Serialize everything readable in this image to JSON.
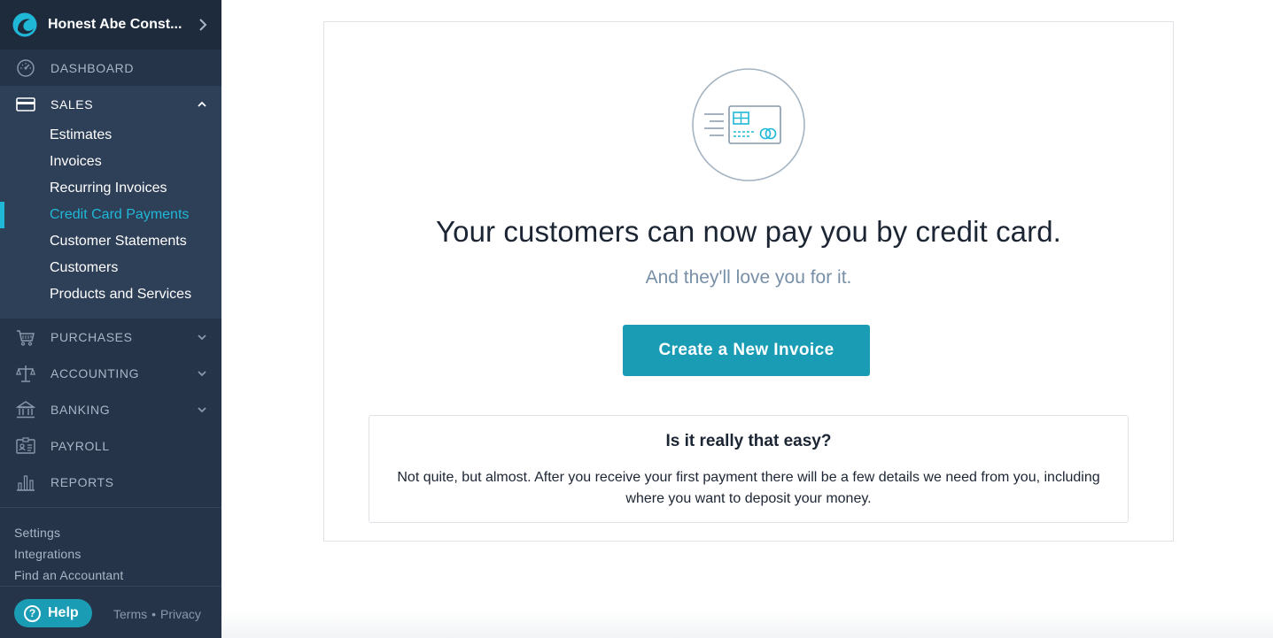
{
  "business": {
    "name": "Honest Abe Const..."
  },
  "nav": {
    "dashboard": "DASHBOARD",
    "sales": "SALES",
    "purchases": "PURCHASES",
    "accounting": "ACCOUNTING",
    "banking": "BANKING",
    "payroll": "PAYROLL",
    "reports": "REPORTS"
  },
  "sales_submenu": [
    "Estimates",
    "Invoices",
    "Recurring Invoices",
    "Credit Card Payments",
    "Customer Statements",
    "Customers",
    "Products and Services"
  ],
  "active_submenu_item": "Credit Card Payments",
  "footer": {
    "settings": "Settings",
    "integrations": "Integrations",
    "find_accountant": "Find an Accountant",
    "help": "Help",
    "help_icon_glyph": "?",
    "terms": "Terms",
    "separator": "•",
    "privacy": "Privacy"
  },
  "main": {
    "headline": "Your customers can now pay you by credit card.",
    "subheadline": "And they'll love you for it.",
    "cta_label": "Create a New Invoice",
    "info_title": "Is it really that easy?",
    "info_body": "Not quite, but almost. After you receive your first payment there will be a few details we need from you, including where you want to deposit your money."
  },
  "colors": {
    "sidebar_bg": "#253449",
    "sidebar_header_bg": "#1d2b3d",
    "sidebar_expanded_bg": "#2e3f58",
    "accent": "#1fb8d6",
    "button": "#1a9cb5",
    "text_dark": "#1c2533",
    "text_muted": "#7890a7"
  },
  "icons": {
    "business_logo": "wave-logo-icon",
    "dashboard": "gauge-icon",
    "sales": "credit-card-icon",
    "purchases": "cart-icon",
    "accounting": "scales-icon",
    "banking": "bank-icon",
    "payroll": "id-badge-icon",
    "reports": "bar-chart-icon",
    "illustration": "credit-card-illustration-icon"
  }
}
